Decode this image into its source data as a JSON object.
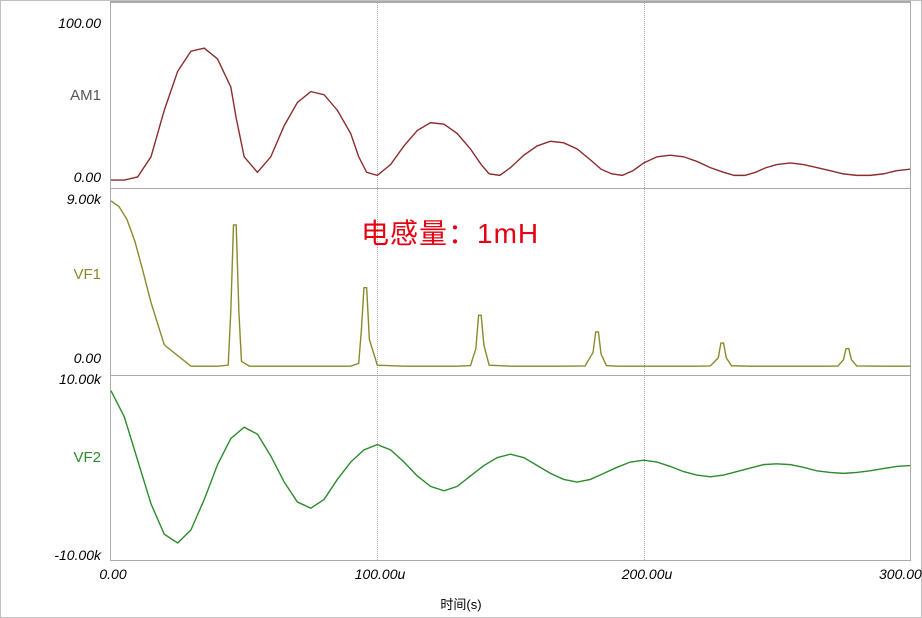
{
  "chart_data": [
    {
      "type": "line",
      "name": "AM1",
      "color": "#8b2d2d",
      "ylim": [
        0,
        100
      ],
      "ytick_labels": [
        "0.00",
        "100.00"
      ],
      "x": [
        0,
        5,
        10,
        15,
        20,
        25,
        30,
        35,
        40,
        45,
        47,
        50,
        55,
        60,
        65,
        70,
        75,
        80,
        85,
        90,
        93,
        96,
        100,
        105,
        110,
        115,
        120,
        125,
        130,
        135,
        139,
        142,
        146,
        150,
        155,
        160,
        165,
        170,
        175,
        180,
        184,
        188,
        192,
        196,
        200,
        205,
        210,
        215,
        220,
        225,
        230,
        234,
        238,
        242,
        246,
        250,
        255,
        260,
        265,
        270,
        275,
        280,
        285,
        290,
        295,
        300
      ],
      "y": [
        0,
        0,
        2,
        15,
        45,
        70,
        83,
        85,
        78,
        60,
        40,
        15,
        5,
        15,
        35,
        50,
        57,
        55,
        45,
        30,
        15,
        5,
        3,
        10,
        22,
        32,
        37,
        36,
        30,
        20,
        10,
        4,
        3,
        8,
        16,
        22,
        25,
        24,
        20,
        13,
        7,
        4,
        3,
        6,
        11,
        15,
        16,
        15,
        12,
        8,
        5,
        3,
        3,
        5,
        8,
        10,
        11,
        10,
        8,
        6,
        4,
        3,
        3,
        4,
        6,
        7
      ]
    },
    {
      "type": "line",
      "name": "VF1",
      "color": "#8a8a2a",
      "ylim": [
        0,
        9000
      ],
      "ytick_labels": [
        "0.00",
        "9.00k"
      ],
      "x": [
        0,
        3,
        6,
        9,
        12,
        15,
        20,
        30,
        40,
        44,
        45,
        46,
        47,
        48,
        49,
        52,
        60,
        70,
        80,
        90,
        93,
        94,
        95,
        96,
        97,
        100,
        110,
        120,
        130,
        135,
        137,
        138,
        139,
        140,
        142,
        150,
        160,
        170,
        178,
        181,
        182,
        183,
        184,
        186,
        190,
        200,
        210,
        220,
        225,
        228,
        229,
        230,
        231,
        233,
        240,
        250,
        260,
        270,
        273,
        275,
        276,
        277,
        278,
        280,
        290,
        300
      ],
      "y": [
        9000,
        8700,
        8000,
        6800,
        5200,
        3500,
        1200,
        50,
        50,
        100,
        3000,
        7700,
        7700,
        3000,
        300,
        50,
        50,
        50,
        50,
        50,
        200,
        2000,
        4300,
        4300,
        1500,
        100,
        50,
        50,
        50,
        80,
        1000,
        2800,
        2800,
        1200,
        100,
        50,
        50,
        50,
        60,
        800,
        1900,
        1900,
        700,
        80,
        50,
        50,
        50,
        50,
        60,
        500,
        1300,
        1300,
        500,
        70,
        50,
        50,
        50,
        50,
        60,
        400,
        1000,
        1000,
        400,
        60,
        50,
        50
      ]
    },
    {
      "type": "line",
      "name": "VF2",
      "color": "#2d8b2d",
      "ylim": [
        -10000,
        10000
      ],
      "ytick_labels": [
        "-10.00k",
        "10.00k"
      ],
      "x": [
        0,
        5,
        10,
        15,
        20,
        25,
        30,
        35,
        40,
        45,
        50,
        55,
        60,
        65,
        70,
        75,
        80,
        85,
        90,
        95,
        100,
        105,
        110,
        115,
        120,
        125,
        130,
        135,
        140,
        145,
        150,
        155,
        160,
        165,
        170,
        175,
        180,
        185,
        190,
        195,
        200,
        205,
        210,
        215,
        220,
        225,
        230,
        235,
        240,
        245,
        250,
        255,
        260,
        265,
        270,
        275,
        280,
        285,
        290,
        295,
        300
      ],
      "y": [
        9000,
        6000,
        1000,
        -4000,
        -7500,
        -8500,
        -7000,
        -3500,
        500,
        3500,
        4800,
        4000,
        1500,
        -1500,
        -3800,
        -4500,
        -3500,
        -1200,
        800,
        2200,
        2800,
        2200,
        800,
        -800,
        -2000,
        -2500,
        -2000,
        -800,
        400,
        1300,
        1700,
        1300,
        400,
        -500,
        -1200,
        -1500,
        -1200,
        -500,
        200,
        800,
        1000,
        800,
        300,
        -300,
        -700,
        -900,
        -700,
        -300,
        100,
        500,
        600,
        500,
        200,
        -200,
        -400,
        -500,
        -400,
        -200,
        50,
        300,
        400
      ]
    }
  ],
  "x_axis": {
    "range": [
      0,
      300
    ],
    "tick_positions": [
      0,
      100,
      200,
      300
    ],
    "tick_labels": [
      "0.00",
      "100.00u",
      "200.00u",
      "300.00u"
    ],
    "gridline_positions": [
      100,
      200
    ],
    "title": "时间(s)"
  },
  "annotation": {
    "text": "电感量：1mH",
    "color": "#e60012"
  },
  "panel_labels": {
    "am1": "AM1",
    "vf1": "VF1",
    "vf2": "VF2"
  }
}
